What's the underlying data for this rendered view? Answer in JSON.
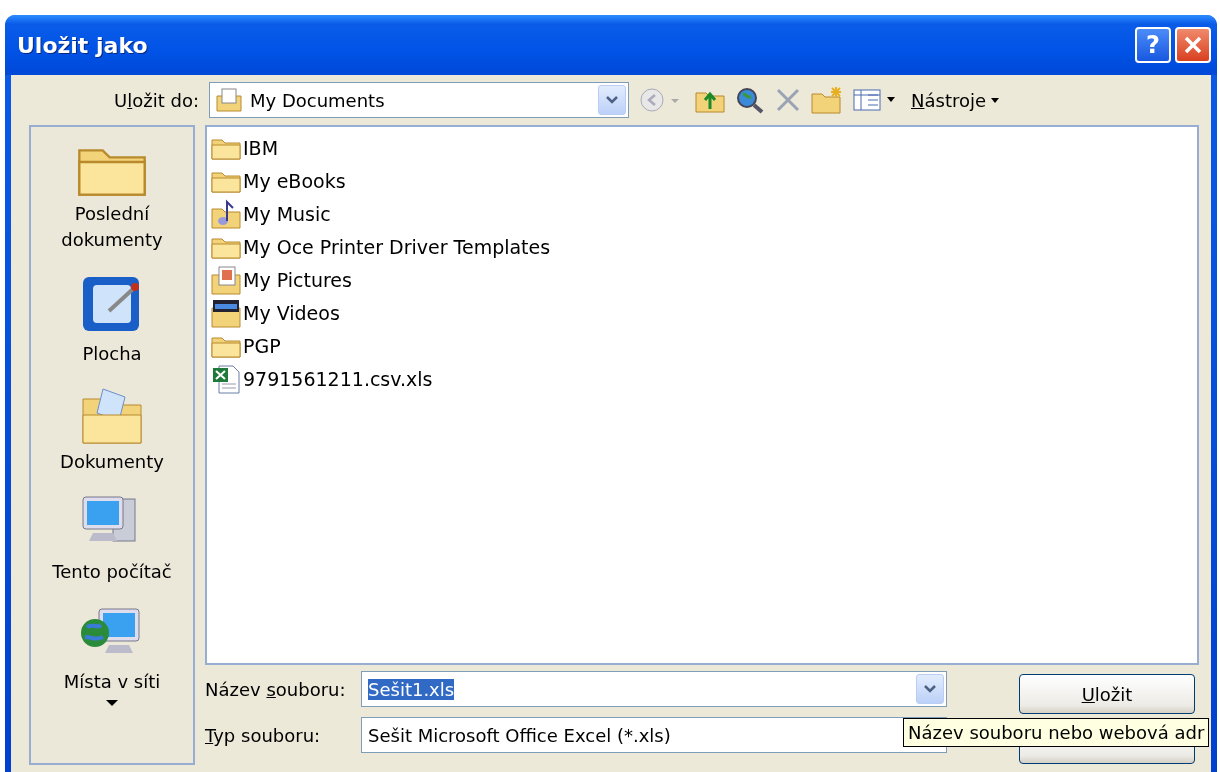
{
  "window": {
    "title": "Uložit jako"
  },
  "title_buttons": [
    {
      "kind": "help",
      "label": "?"
    },
    {
      "kind": "close"
    }
  ],
  "save_in": {
    "label": {
      "before": "U",
      "key": "l",
      "after": "ožit do:"
    },
    "value": "My Documents"
  },
  "toolbar": {
    "tools_label": {
      "key": "N",
      "after": "ástroje"
    }
  },
  "places": [
    {
      "kind": "recent",
      "label": "Poslední dokumenty"
    },
    {
      "kind": "desktop",
      "label": "Plocha"
    },
    {
      "kind": "documents",
      "label": "Dokumenty"
    },
    {
      "kind": "computer",
      "label": "Tento počítač"
    },
    {
      "kind": "network",
      "label": "Místa v síti"
    }
  ],
  "files": [
    {
      "kind": "folder",
      "name": "IBM"
    },
    {
      "kind": "folder",
      "name": "My eBooks"
    },
    {
      "kind": "music",
      "name": "My Music"
    },
    {
      "kind": "folder",
      "name": "My Oce Printer Driver Templates"
    },
    {
      "kind": "pictures",
      "name": "My Pictures"
    },
    {
      "kind": "videos",
      "name": "My Videos"
    },
    {
      "kind": "folder",
      "name": "PGP"
    },
    {
      "kind": "excel",
      "name": "9791561211.csv.xls"
    }
  ],
  "file_name": {
    "label": {
      "before": "Název ",
      "key": "s",
      "after": "ouboru:"
    },
    "value": "Sešit1.xls",
    "selected": true
  },
  "file_type": {
    "label": {
      "key": "T",
      "after": "yp souboru:"
    },
    "value": "Sešit Microsoft Office Excel (*.xls)"
  },
  "buttons": [
    {
      "kind": "text",
      "label": {
        "key": "U",
        "after": "ložit"
      }
    },
    {
      "kind": "covered"
    }
  ],
  "tooltip": "Název souboru nebo webová adr"
}
